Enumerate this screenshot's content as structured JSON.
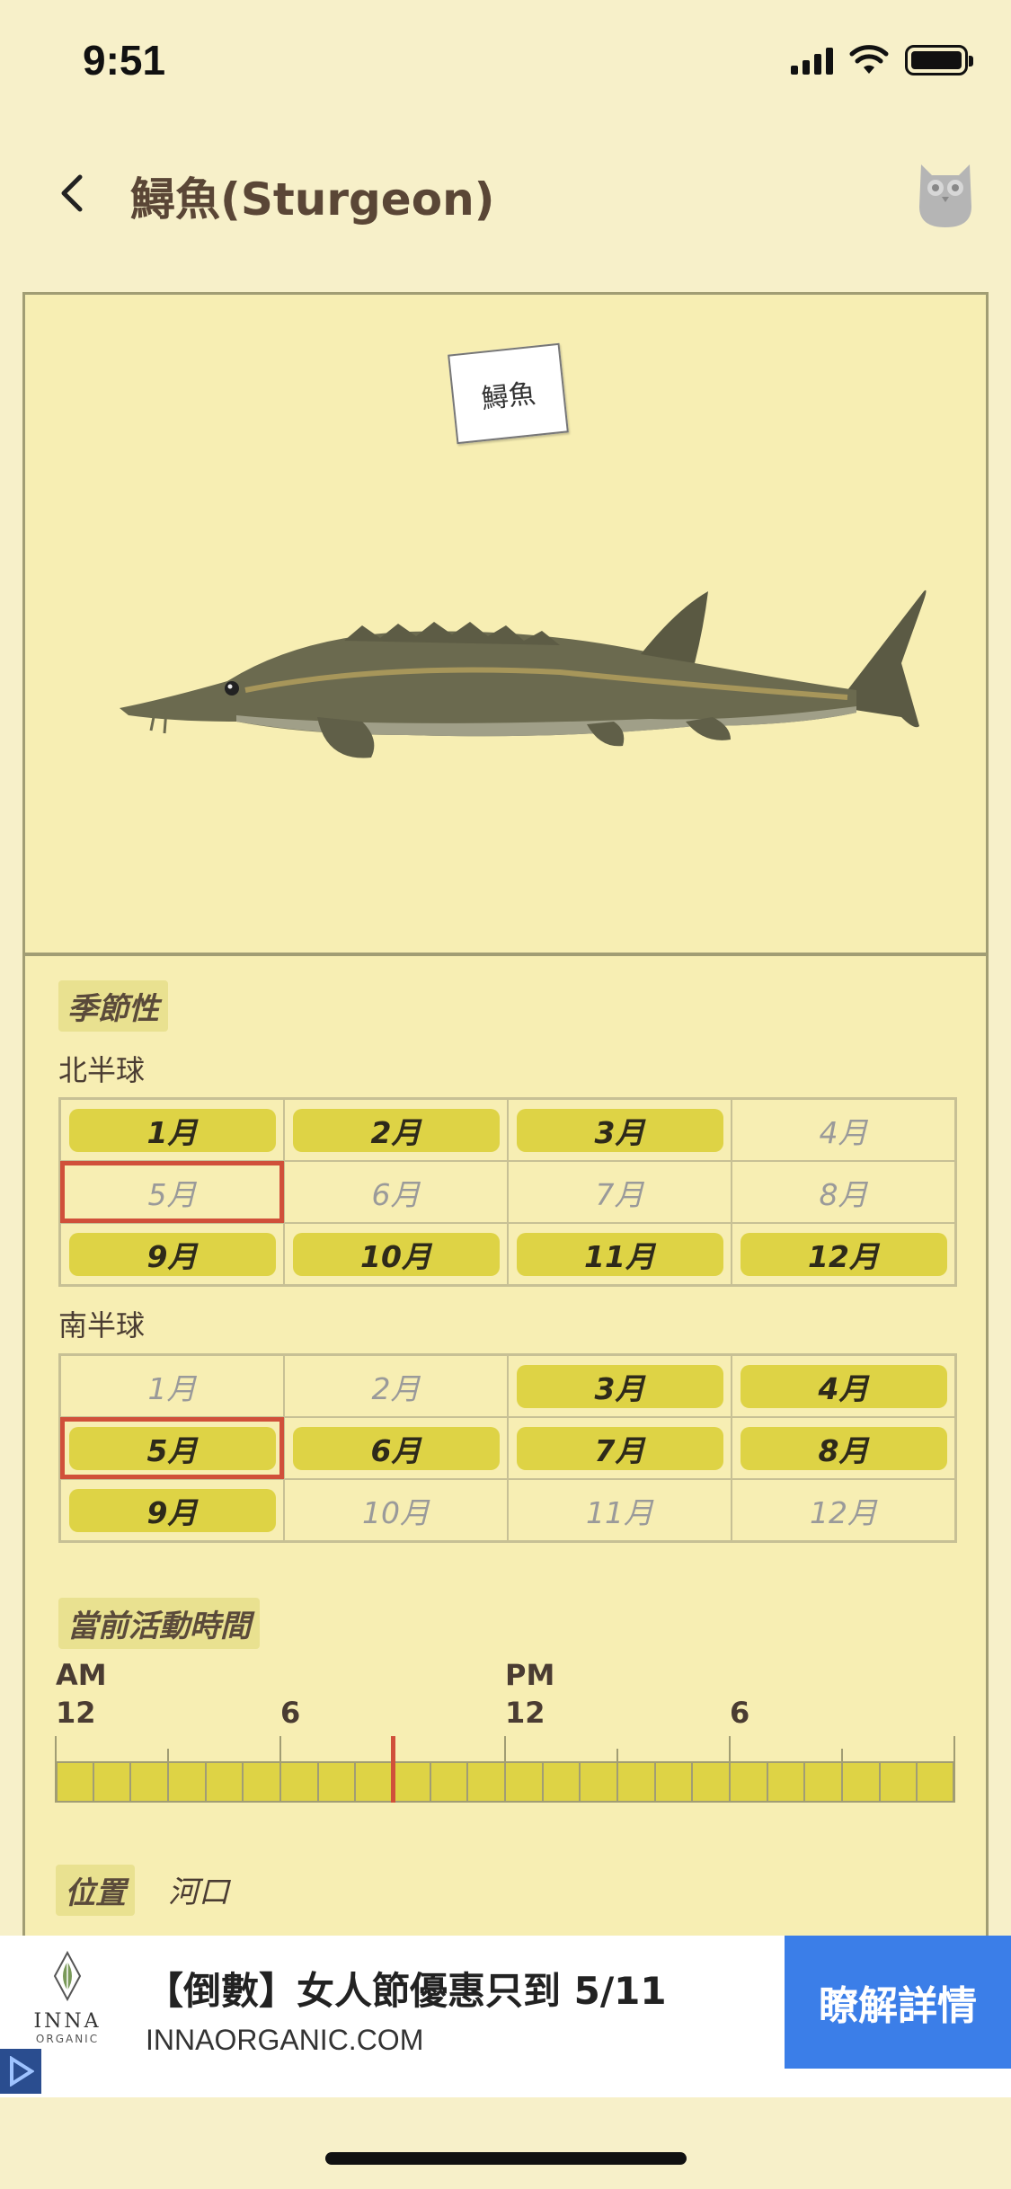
{
  "status_bar": {
    "time": "9:51"
  },
  "header": {
    "title": "鱘魚(Sturgeon)"
  },
  "creature": {
    "name_tag": "鱘魚"
  },
  "seasonality": {
    "label": "季節性",
    "north": {
      "label": "北半球",
      "months": [
        {
          "label": "1月",
          "active": true
        },
        {
          "label": "2月",
          "active": true
        },
        {
          "label": "3月",
          "active": true
        },
        {
          "label": "4月",
          "active": false
        },
        {
          "label": "5月",
          "active": false,
          "current": true
        },
        {
          "label": "6月",
          "active": false
        },
        {
          "label": "7月",
          "active": false
        },
        {
          "label": "8月",
          "active": false
        },
        {
          "label": "9月",
          "active": true
        },
        {
          "label": "10月",
          "active": true
        },
        {
          "label": "11月",
          "active": true
        },
        {
          "label": "12月",
          "active": true
        }
      ]
    },
    "south": {
      "label": "南半球",
      "months": [
        {
          "label": "1月",
          "active": false
        },
        {
          "label": "2月",
          "active": false
        },
        {
          "label": "3月",
          "active": true
        },
        {
          "label": "4月",
          "active": true
        },
        {
          "label": "5月",
          "active": true,
          "current": true
        },
        {
          "label": "6月",
          "active": true
        },
        {
          "label": "7月",
          "active": true
        },
        {
          "label": "8月",
          "active": true
        },
        {
          "label": "9月",
          "active": true
        },
        {
          "label": "10月",
          "active": false
        },
        {
          "label": "11月",
          "active": false
        },
        {
          "label": "12月",
          "active": false
        }
      ]
    }
  },
  "activity_time": {
    "label": "當前活動時間",
    "am": "AM",
    "pm": "PM",
    "ticks": [
      "12",
      "6",
      "12",
      "6"
    ],
    "current_hour": 9
  },
  "location": {
    "label": "位置",
    "value": "河口"
  },
  "ad": {
    "logo_text": "INNA",
    "logo_sub": "ORGANIC",
    "headline": "【倒數】女人節優惠只到 5/11",
    "domain": "INNAORGANIC.COM",
    "cta": "瞭解詳情"
  },
  "colors": {
    "accent": "#ded345",
    "current_marker": "#d0503a",
    "background": "#f7f0c9",
    "ad_cta": "#3b7ee8"
  }
}
